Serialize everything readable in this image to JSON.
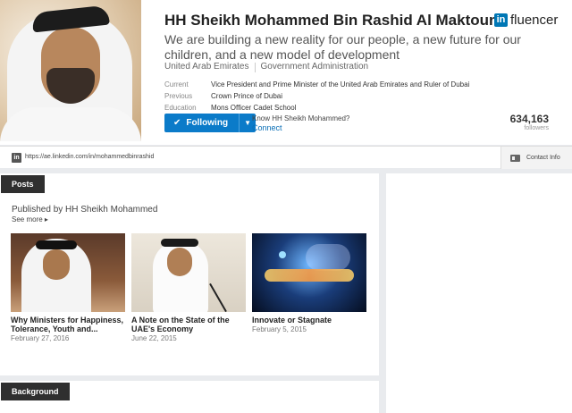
{
  "profile": {
    "name": "HH Sheikh Mohammed Bin Rashid Al Maktoum",
    "headline": "We are building a new reality for our people, a new future for our children, and a new model of development",
    "location": "United Arab Emirates",
    "industry": "Government Administration",
    "facts": [
      {
        "label": "Current",
        "value": "Vice President and Prime Minister of the United Arab Emirates and Ruler of Dubai"
      },
      {
        "label": "Previous",
        "value": "Crown Prince of Dubai"
      },
      {
        "label": "Education",
        "value": "Mons Officer Cadet School"
      }
    ],
    "follow_label": "Following",
    "know_text": "Know HH Sheikh Mohammed?",
    "connect_label": "Connect",
    "followers_count": "634,163",
    "followers_label": "followers"
  },
  "brand": {
    "logo_text": "in",
    "text": "fluencer"
  },
  "urlbar": {
    "logo_text": "in",
    "url": "https://ae.linkedin.com/in/mohammedbinrashid",
    "contact_label": "Contact Info"
  },
  "posts": {
    "tab_label": "Posts",
    "published_by": "Published by HH Sheikh Mohammed",
    "see_more": "See more ▸",
    "items": [
      {
        "title": "Why Ministers for Happiness, Tolerance, Youth and...",
        "date": "February 27, 2016"
      },
      {
        "title": "A Note on the State of the UAE's Economy",
        "date": "June 22, 2015"
      },
      {
        "title": "Innovate or Stagnate",
        "date": "February 5, 2015"
      }
    ]
  },
  "background_section": {
    "tab_label": "Background"
  },
  "colors": {
    "accent": "#0b7bc9",
    "brand": "#0077b5",
    "tab_bg": "#2f2f2f"
  }
}
